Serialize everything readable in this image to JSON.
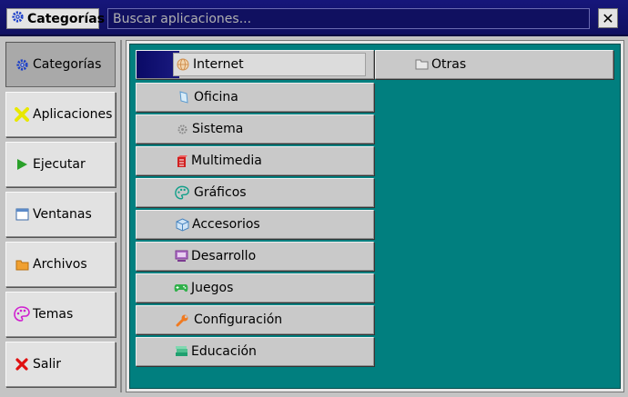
{
  "titlebar": {
    "title": "Categorías",
    "search_placeholder": "Buscar aplicaciones...",
    "close_label": "✕"
  },
  "sidebar": {
    "items": [
      {
        "label": "Categorías",
        "icon": "gear-icon",
        "active": true
      },
      {
        "label": "Aplicaciones",
        "icon": "puzzle-icon"
      },
      {
        "label": "Ejecutar",
        "icon": "play-icon"
      },
      {
        "label": "Ventanas",
        "icon": "window-icon"
      },
      {
        "label": "Archivos",
        "icon": "folder-icon"
      },
      {
        "label": "Temas",
        "icon": "palette-icon"
      },
      {
        "label": "Salir",
        "icon": "close-icon"
      }
    ]
  },
  "categories": {
    "left": [
      {
        "label": "Internet",
        "icon": "globe-icon",
        "selected": true
      },
      {
        "label": "Oficina",
        "icon": "office-icon"
      },
      {
        "label": "Sistema",
        "icon": "gear-icon"
      },
      {
        "label": "Multimedia",
        "icon": "multimedia-icon"
      },
      {
        "label": "Gráficos",
        "icon": "palette-icon"
      },
      {
        "label": "Accesorios",
        "icon": "box-icon"
      },
      {
        "label": "Desarrollo",
        "icon": "computer-icon"
      },
      {
        "label": "Juegos",
        "icon": "gamepad-icon"
      },
      {
        "label": "Configuración",
        "icon": "wrench-icon"
      },
      {
        "label": "Educación",
        "icon": "books-icon"
      }
    ],
    "right": [
      {
        "label": "Otras",
        "icon": "folder-icon"
      }
    ]
  },
  "colors": {
    "titlebar": "#16167a",
    "panel_bg": "#017f7f",
    "button_bg": "#c9c9c9",
    "active_sidebar": "#a9a9a9"
  }
}
